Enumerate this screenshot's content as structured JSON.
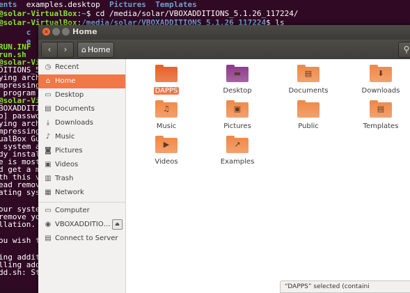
{
  "terminal": {
    "lines": [
      {
        "parts": [
          {
            "c": "b",
            "t": "ents"
          },
          {
            "c": "w",
            "t": "  examples.desktop  "
          },
          {
            "c": "b",
            "t": "Pictures"
          },
          {
            "c": "w",
            "t": "  "
          },
          {
            "c": "b",
            "t": "Templates"
          }
        ]
      },
      {
        "parts": [
          {
            "c": "g",
            "t": "@solar-VirtualBox"
          },
          {
            "c": "w",
            "t": ":"
          },
          {
            "c": "b",
            "t": "~"
          },
          {
            "c": "w",
            "t": "$ cd /media/solar/VBOXADDITIONS_5.1.26_117224/"
          }
        ]
      },
      {
        "parts": [
          {
            "c": "g",
            "t": "@solar-VirtualBox"
          },
          {
            "c": "w",
            "t": ":"
          },
          {
            "c": "b",
            "t": "/media/solar/VBOXADDITIONS_5.1.26_117224"
          },
          {
            "c": "w",
            "t": "$ ls"
          }
        ]
      },
      {
        "parts": [
          {
            "c": "b",
            "t": "      c"
          }
        ]
      },
      {
        "parts": [
          {
            "c": "b",
            "t": "      e"
          }
        ]
      },
      {
        "parts": [
          {
            "c": "g",
            "t": "RUN.INF  r"
          }
        ]
      },
      {
        "parts": [
          {
            "c": "g",
            "t": "run.sh   V"
          }
        ]
      },
      {
        "parts": [
          {
            "c": "g",
            "t": "@solar-Vi"
          }
        ]
      },
      {
        "parts": [
          {
            "c": "w",
            "t": "DITIONS_5."
          }
        ]
      },
      {
        "parts": [
          {
            "c": "w",
            "t": "ying arch"
          }
        ]
      },
      {
        "parts": [
          {
            "c": "w",
            "t": "mpressing"
          }
        ]
      },
      {
        "parts": [
          {
            "c": "w",
            "t": " program m"
          }
        ]
      },
      {
        "parts": [
          {
            "c": "g",
            "t": "@solar-Vi"
          }
        ]
      },
      {
        "parts": [
          {
            "c": "w",
            "t": "BOXADDITI"
          }
        ]
      },
      {
        "parts": [
          {
            "c": "w",
            "t": "o] passwo"
          }
        ]
      },
      {
        "parts": [
          {
            "c": "w",
            "t": "ying arch"
          }
        ]
      },
      {
        "parts": [
          {
            "c": "w",
            "t": "mpressing"
          }
        ]
      },
      {
        "parts": [
          {
            "c": "w",
            "t": "ualBox Gue"
          }
        ]
      },
      {
        "parts": [
          {
            "c": "w",
            "t": " system ap"
          }
        ]
      },
      {
        "parts": [
          {
            "c": "w",
            "t": "dy instal"
          }
        ]
      },
      {
        "parts": [
          {
            "c": "w",
            "t": "e is most"
          }
        ]
      },
      {
        "parts": [
          {
            "c": "w",
            "t": "d get a m"
          }
        ]
      },
      {
        "parts": [
          {
            "c": "w",
            "t": "th this v"
          }
        ]
      },
      {
        "parts": [
          {
            "c": "w",
            "t": "ead remove"
          }
        ]
      },
      {
        "parts": [
          {
            "c": "w",
            "t": "ating syst"
          }
        ]
      },
      {
        "parts": [
          {
            "c": "w",
            "t": ""
          }
        ]
      },
      {
        "parts": [
          {
            "c": "w",
            "t": "our system"
          }
        ]
      },
      {
        "parts": [
          {
            "c": "w",
            "t": "remove you"
          }
        ]
      },
      {
        "parts": [
          {
            "c": "w",
            "t": "llation."
          }
        ]
      },
      {
        "parts": [
          {
            "c": "w",
            "t": ""
          }
        ]
      },
      {
        "parts": [
          {
            "c": "w",
            "t": "ou wish to"
          }
        ]
      },
      {
        "parts": [
          {
            "c": "w",
            "t": ""
          }
        ]
      },
      {
        "parts": [
          {
            "c": "w",
            "t": "ing additi"
          }
        ]
      },
      {
        "parts": [
          {
            "c": "w",
            "t": "lling add"
          }
        ]
      },
      {
        "parts": [
          {
            "c": "w",
            "t": "dd.sh: St"
          }
        ]
      }
    ]
  },
  "window": {
    "title": "Home",
    "close_glyph": "×",
    "min_glyph": "–",
    "max_glyph": "□"
  },
  "toolbar": {
    "back_glyph": "‹",
    "forward_glyph": "›",
    "breadcrumb_label": "Home",
    "home_glyph": "⌂",
    "search_glyph": "⚲"
  },
  "sidebar": {
    "items": [
      {
        "label": "Recent",
        "icon": "clock-icon",
        "glyph": "◷",
        "selected": false
      },
      {
        "label": "Home",
        "icon": "home-icon",
        "glyph": "⌂",
        "selected": true
      },
      {
        "label": "Desktop",
        "icon": "desktop-icon",
        "glyph": "▭",
        "selected": false
      },
      {
        "label": "Documents",
        "icon": "documents-icon",
        "glyph": "▤",
        "selected": false
      },
      {
        "label": "Downloads",
        "icon": "downloads-icon",
        "glyph": "⤓",
        "selected": false
      },
      {
        "label": "Music",
        "icon": "music-icon",
        "glyph": "♪",
        "selected": false
      },
      {
        "label": "Pictures",
        "icon": "camera-icon",
        "glyph": "◙",
        "selected": false
      },
      {
        "label": "Videos",
        "icon": "videos-icon",
        "glyph": "▣",
        "selected": false
      },
      {
        "label": "Trash",
        "icon": "trash-icon",
        "glyph": "▥",
        "selected": false
      },
      {
        "label": "Network",
        "icon": "network-icon",
        "glyph": "▦",
        "selected": false
      }
    ],
    "devices": [
      {
        "label": "Computer",
        "icon": "computer-icon",
        "glyph": "▭"
      },
      {
        "label": "VBOXADDITIO…",
        "icon": "disc-icon",
        "glyph": "◉",
        "eject_glyph": "⏏"
      },
      {
        "label": "Connect to Server",
        "icon": "server-icon",
        "glyph": "▤"
      }
    ]
  },
  "files": [
    {
      "name": "DAPPS",
      "icon": "folder-icon",
      "glyph": "",
      "selected": true,
      "color": "#e8622c"
    },
    {
      "name": "Desktop",
      "icon": "desktop-folder-icon",
      "glyph": "▬",
      "selected": false,
      "color": "#8e3e8c"
    },
    {
      "name": "Documents",
      "icon": "documents-folder-icon",
      "glyph": "▤",
      "selected": false,
      "color": "#f08a4a"
    },
    {
      "name": "Downloads",
      "icon": "downloads-folder-icon",
      "glyph": "⬇",
      "selected": false,
      "color": "#f08a4a"
    },
    {
      "name": "Music",
      "icon": "music-folder-icon",
      "glyph": "♫",
      "selected": false,
      "color": "#f08a4a"
    },
    {
      "name": "Pictures",
      "icon": "pictures-folder-icon",
      "glyph": "▣",
      "selected": false,
      "color": "#f08a4a"
    },
    {
      "name": "Public",
      "icon": "public-folder-icon",
      "glyph": "",
      "selected": false,
      "color": "#f08a4a"
    },
    {
      "name": "Templates",
      "icon": "templates-folder-icon",
      "glyph": "▤",
      "selected": false,
      "color": "#f08a4a"
    },
    {
      "name": "Videos",
      "icon": "videos-folder-icon",
      "glyph": "▶",
      "selected": false,
      "color": "#f08a4a"
    },
    {
      "name": "Examples",
      "icon": "examples-folder-icon",
      "glyph": "↗",
      "selected": false,
      "color": "#f08a4a"
    }
  ],
  "status": {
    "text": "“DAPPS” selected  (containi"
  },
  "colors": {
    "accent": "#f07746",
    "terminal_bg": "#300a24",
    "titlebar": "#3c3b37"
  }
}
